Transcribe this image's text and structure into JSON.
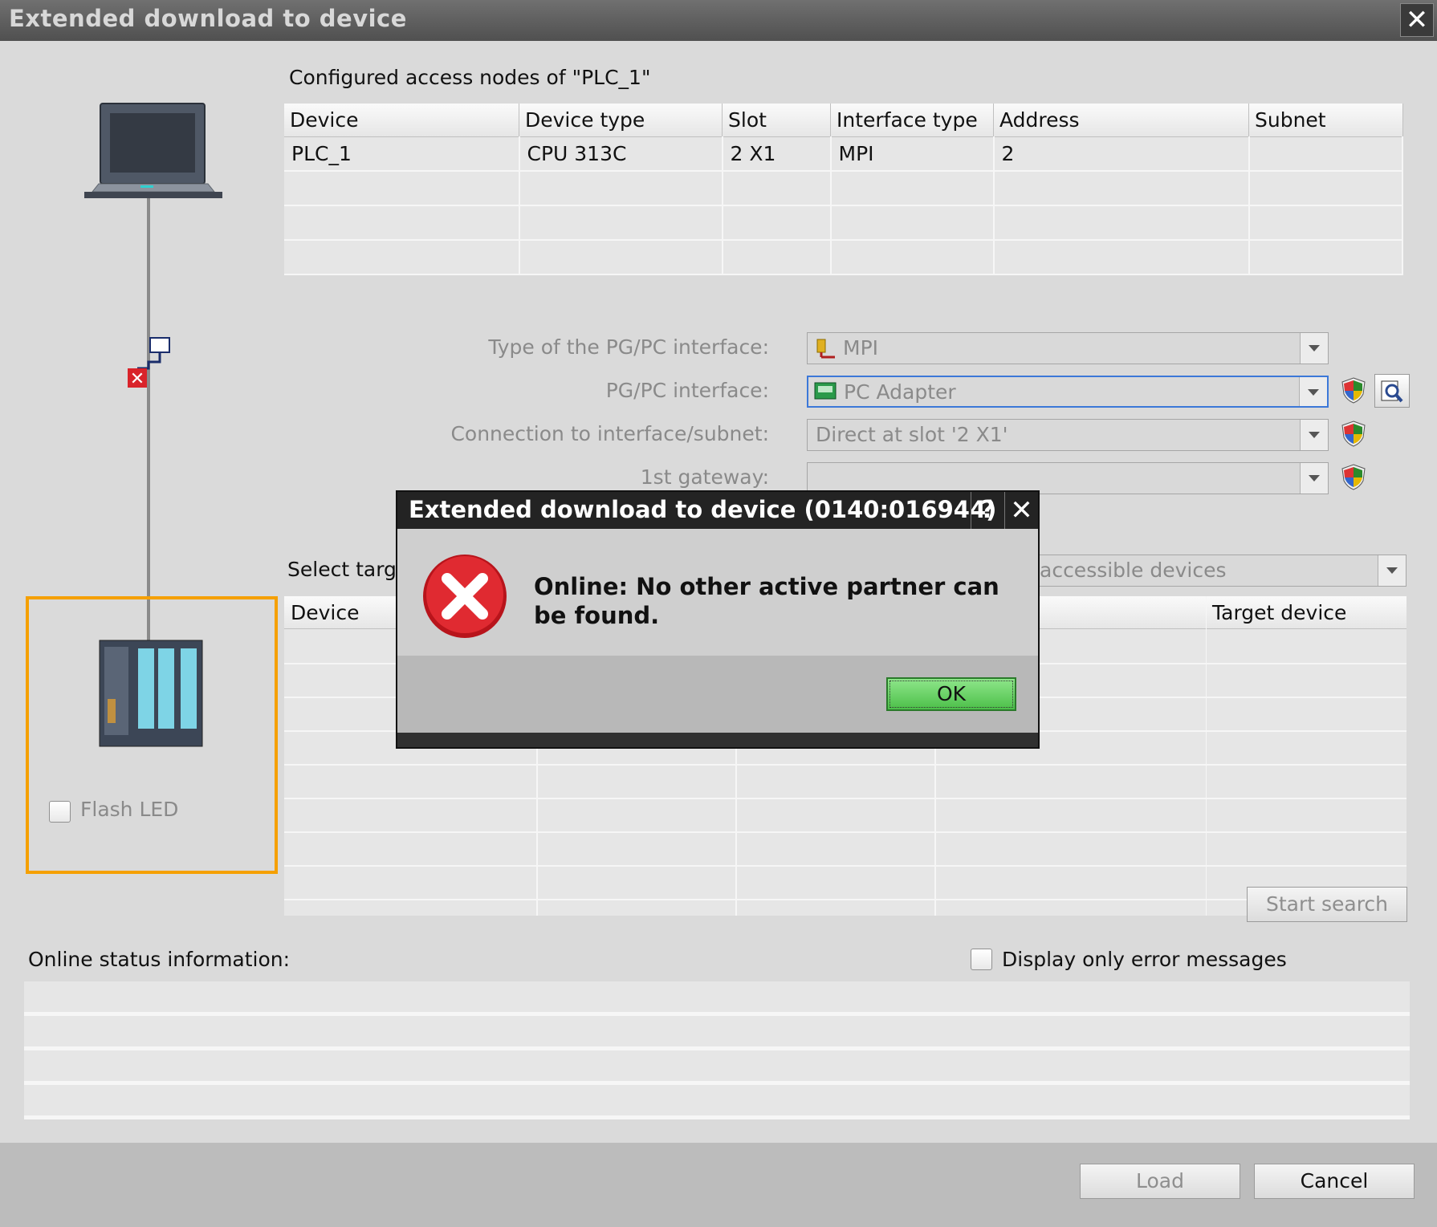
{
  "window": {
    "title": "Extended download to device",
    "close_glyph": "✕"
  },
  "configured": {
    "heading": "Configured access nodes of \"PLC_1\"",
    "columns": [
      "Device",
      "Device type",
      "Slot",
      "Interface type",
      "Address",
      "Subnet"
    ],
    "rows": [
      [
        "PLC_1",
        "CPU 313C",
        "2 X1",
        "MPI",
        "2",
        ""
      ],
      [
        "",
        "",
        "",
        "",
        "",
        ""
      ],
      [
        "",
        "",
        "",
        "",
        "",
        ""
      ],
      [
        "",
        "",
        "",
        "",
        "",
        ""
      ]
    ]
  },
  "interface": {
    "type_label": "Type of the PG/PC interface:",
    "type_value": "MPI",
    "pgpc_label": "PG/PC interface:",
    "pgpc_value": "PC Adapter",
    "connection_label": "Connection to interface/subnet:",
    "connection_value": "Direct at slot '2 X1'",
    "gateway_label": "1st gateway:",
    "gateway_value": ""
  },
  "target": {
    "select_label": "Select targ",
    "show_value": "accessible devices",
    "col_device": "Device",
    "col_target": "Target device"
  },
  "flash_led": {
    "label": "Flash LED",
    "checked": false
  },
  "start_search": "Start search",
  "online_status": {
    "label": "Online status information:"
  },
  "error_only": {
    "label": "Display only error messages",
    "checked": false
  },
  "footer": {
    "load": "Load",
    "cancel": "Cancel"
  },
  "dialog": {
    "title": "Extended download to device (0140:016944)",
    "help": "?",
    "close": "✕",
    "message": "Online: No other active partner can be found.",
    "ok": "OK"
  },
  "colors": {
    "accent": "#f5a000",
    "ok_green": "#4cbf49",
    "error_red": "#d9232a",
    "focus_blue": "#3c78d8"
  }
}
